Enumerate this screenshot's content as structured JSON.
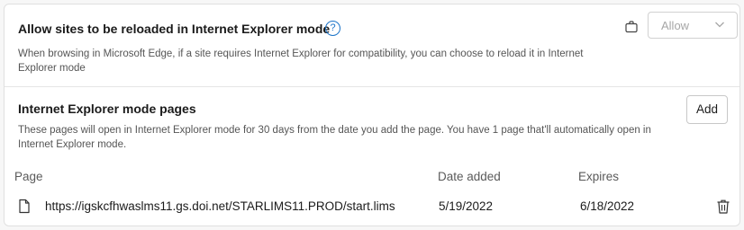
{
  "ie_reload": {
    "title": "Allow sites to be reloaded in Internet Explorer mode",
    "help_glyph": "?",
    "description": "When browsing in Microsoft Edge, if a site requires Internet Explorer for compatibility, you can choose to reload it in Internet Explorer mode",
    "select_value": "Allow"
  },
  "ie_pages": {
    "title": "Internet Explorer mode pages",
    "description": "These pages will open in Internet Explorer mode for 30 days from the date you add the page. You have 1 page that'll automatically open in Internet Explorer mode.",
    "add_label": "Add",
    "columns": {
      "page": "Page",
      "date_added": "Date added",
      "expires": "Expires"
    },
    "rows": [
      {
        "url": "https://igskcfhwaslms11.gs.doi.net/STARLIMS11.PROD/start.lims",
        "date_added": "5/19/2022",
        "expires": "6/18/2022"
      }
    ]
  },
  "colors": {
    "accent": "#1a73c8",
    "text": "#1b1b1b",
    "muted": "#555555",
    "border": "#e0e0e0"
  },
  "icons": {
    "policy": "briefcase-icon",
    "dropdown": "chevron-down-icon",
    "file": "document-icon",
    "delete": "trash-icon"
  }
}
